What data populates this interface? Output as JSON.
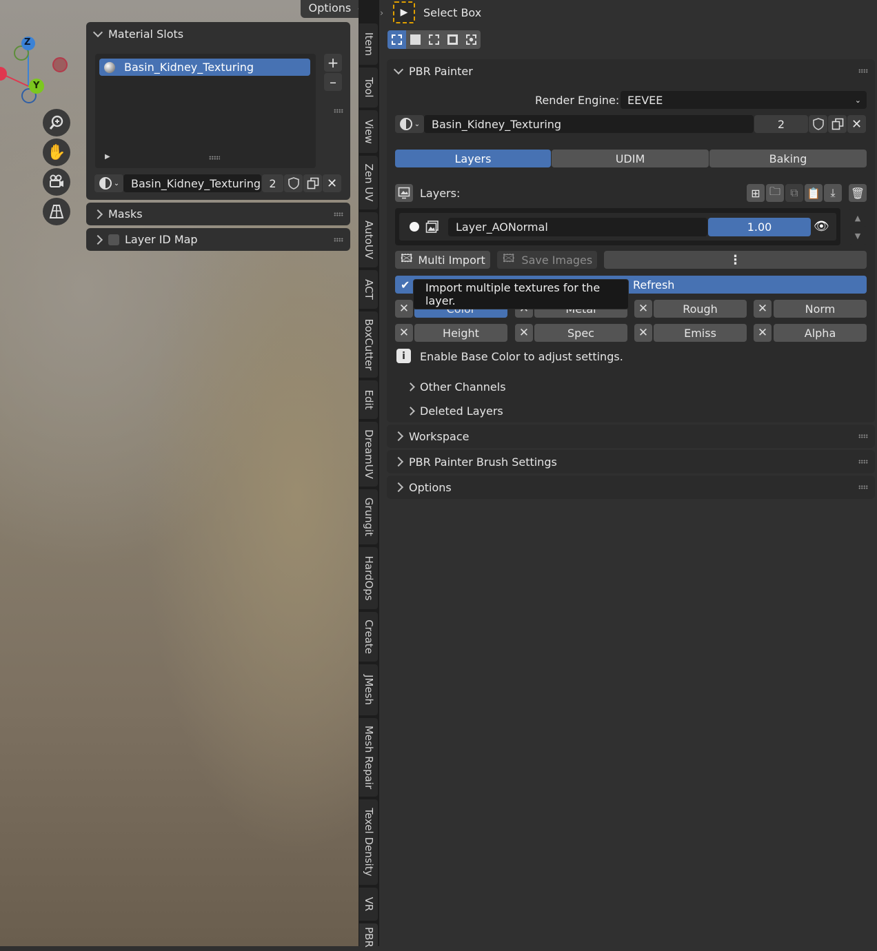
{
  "viewport": {
    "options_label": "Options",
    "gizmo": {
      "z": "Z",
      "y": "Y"
    },
    "nav_icons": [
      "zoom-icon",
      "hand-pan-icon",
      "camera-icon",
      "grid-perspective-icon"
    ]
  },
  "material_slots": {
    "title": "Material Slots",
    "items": [
      {
        "label": "Basin_Kidney_Texturing"
      }
    ],
    "add": "+",
    "remove": "–",
    "material_name": "Basin_Kidney_Texturing",
    "user_count": "2"
  },
  "masks": {
    "title": "Masks"
  },
  "layer_id_map": {
    "title": "Layer ID Map"
  },
  "tabs": [
    "Item",
    "Tool",
    "View",
    "Zen UV",
    "AutoUV",
    "ACT",
    "BoxCutter",
    "Edit",
    "DreamUV",
    "Grungit",
    "HardOps",
    "Create",
    "JMesh",
    "Mesh Repair",
    "Texel Density",
    "VR",
    "PBR"
  ],
  "toolheader": {
    "tool_label": "Select Box"
  },
  "pbr": {
    "title": "PBR Painter",
    "render_engine_label": "Render Engine:",
    "render_engine_value": "EEVEE",
    "material_name": "Basin_Kidney_Texturing",
    "user_count": "2",
    "tabs": [
      "Layers",
      "UDIM",
      "Baking"
    ],
    "active_tab": "Layers",
    "layers_label": "Layers:",
    "layer": {
      "name": "Layer_AONormal",
      "opacity": "1.00"
    },
    "multi_import": "Multi Import",
    "save_images": "Save Images",
    "refresh_label": "Refresh",
    "tooltip": "Import multiple textures for the layer.",
    "channels_row1": [
      "Color",
      "Metal",
      "Rough",
      "Norm"
    ],
    "channels_row2": [
      "Height",
      "Spec",
      "Emiss",
      "Alpha"
    ],
    "info": "Enable Base Color to adjust settings.",
    "other_channels": "Other Channels",
    "deleted_layers": "Deleted Layers"
  },
  "sections": {
    "workspace": "Workspace",
    "brush_settings": "PBR Painter Brush Settings",
    "options": "Options"
  },
  "colors": {
    "accent": "#4772b3",
    "panel": "#303030",
    "field": "#1d1d1d",
    "button": "#545454"
  }
}
